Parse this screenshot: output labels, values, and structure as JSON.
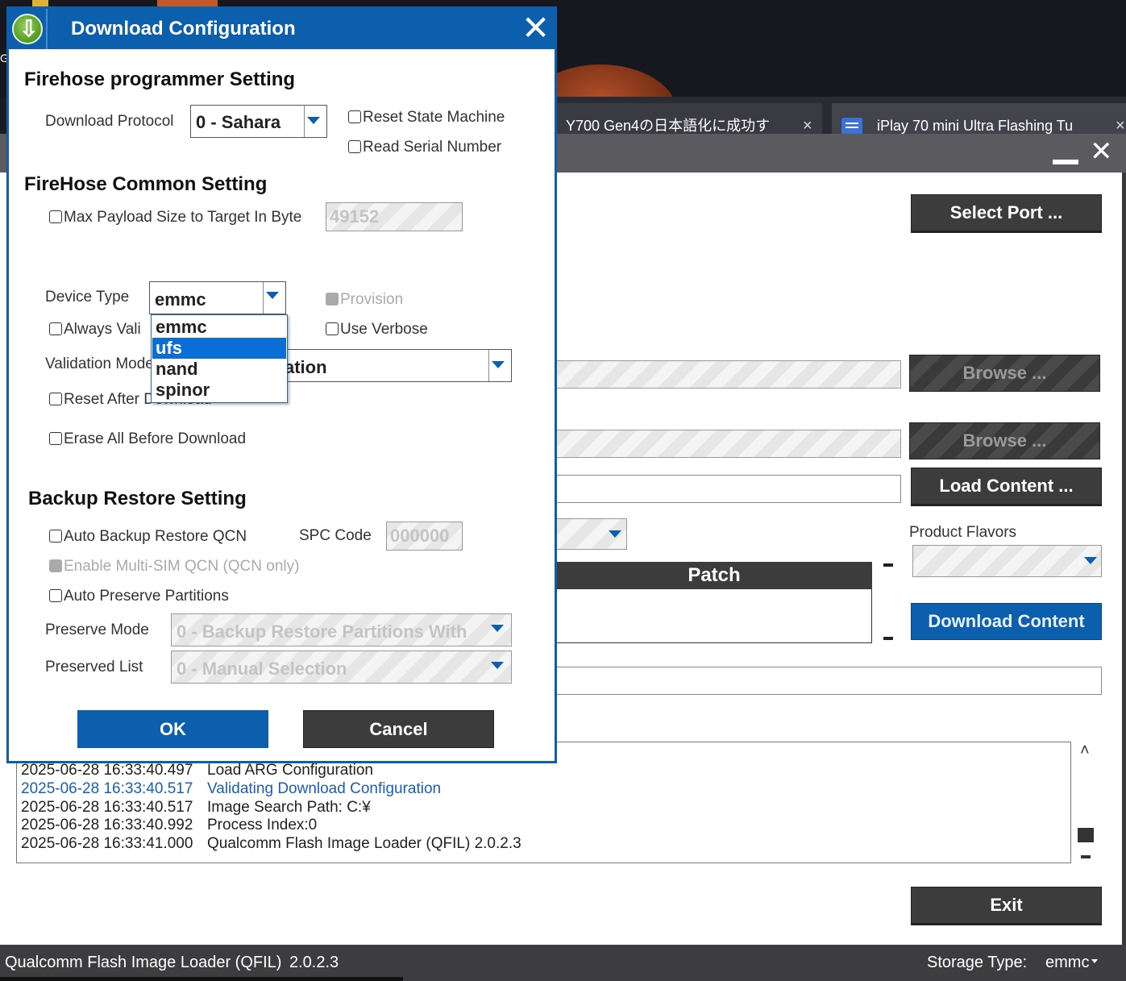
{
  "background": {
    "left_glyph": "G",
    "tabs": [
      {
        "label": "Y700 Gen4の日本語化に成功す",
        "close": "×"
      },
      {
        "label": "iPlay 70 mini Ultra Flashing Tu",
        "close": "×"
      }
    ]
  },
  "main_window": {
    "close_glyph": "✕",
    "buttons": {
      "select_port": "Select Port ...",
      "browse_1": "Browse ...",
      "browse_2": "Browse ...",
      "load_content": "Load Content ...",
      "download_content": "Download Content",
      "exit": "Exit"
    },
    "product_flavors_label": "Product Flavors",
    "patch_header": "Patch",
    "log": [
      {
        "time": "2025-06-28 16:33:40.497",
        "msg": "Load ARG Configuration",
        "highlight": false
      },
      {
        "time": "2025-06-28 16:33:40.517",
        "msg": "Validating Download Configuration",
        "highlight": true
      },
      {
        "time": "2025-06-28 16:33:40.517",
        "msg": "Image Search Path: C:¥",
        "highlight": false
      },
      {
        "time": "2025-06-28 16:33:40.992",
        "msg": "Process Index:0",
        "highlight": false
      },
      {
        "time": "2025-06-28 16:33:41.000",
        "msg": "Qualcomm Flash Image Loader (QFIL) 2.0.2.3",
        "highlight": false
      }
    ],
    "scroll_up": "˄",
    "status": {
      "app_name": "Qualcomm Flash Image Loader (QFIL)",
      "version": "2.0.2.3",
      "storage_label": "Storage Type:",
      "storage_value": "emmc"
    }
  },
  "dialog": {
    "title": "Download Configuration",
    "close_glyph": "✕",
    "firehose_programmer": {
      "heading": "Firehose programmer Setting",
      "protocol_label": "Download Protocol",
      "protocol_value": "0 - Sahara",
      "reset_state_machine": "Reset State Machine",
      "read_serial_number": "Read Serial Number"
    },
    "common": {
      "heading": "FireHose Common Setting",
      "max_payload_label": "Max Payload Size to Target In Byte",
      "max_payload_value": "49152",
      "device_type_label": "Device Type",
      "device_type_value": "emmc",
      "provision": "Provision",
      "always_validate": "Always Vali",
      "use_verbose": "Use Verbose",
      "validation_mode_label": "Validation Mode",
      "validation_mode_value": "ation",
      "reset_after_download": "Reset After Download",
      "erase_all": "Erase All Before Download"
    },
    "device_type_options": [
      {
        "label": "emmc",
        "selected": false
      },
      {
        "label": "ufs",
        "selected": true
      },
      {
        "label": "nand",
        "selected": false
      },
      {
        "label": "spinor",
        "selected": false
      }
    ],
    "backup": {
      "heading": "Backup Restore Setting",
      "auto_backup_qcn": "Auto Backup Restore QCN",
      "spc_code_label": "SPC Code",
      "spc_code_value": "000000",
      "enable_multi_sim": "Enable Multi-SIM QCN (QCN only)",
      "auto_preserve": "Auto Preserve Partitions",
      "preserve_mode_label": "Preserve Mode",
      "preserve_mode_value": "0 - Backup Restore Partitions With",
      "preserved_list_label": "Preserved List",
      "preserved_list_value": "0 - Manual Selection"
    },
    "ok": "OK",
    "cancel": "Cancel"
  },
  "colors": {
    "accent_blue": "#0b5fad",
    "dark_button": "#3c3c3c",
    "dropdown_selected": "#0b6ed6",
    "log_highlight": "#1a5fb4"
  }
}
